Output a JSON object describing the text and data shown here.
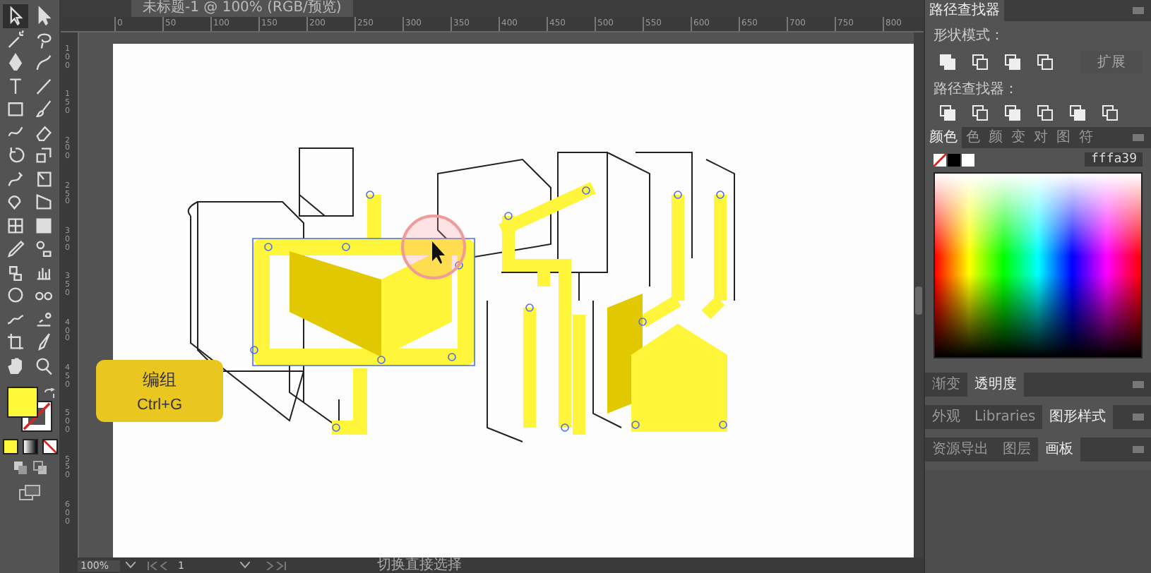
{
  "document_tab": {
    "title": "未标题-1 @ 100% (RGB/预览)"
  },
  "toolbar": {
    "tools": [
      {
        "kind": "select",
        "selected": true
      },
      {
        "kind": "direct",
        "selected": false
      },
      {
        "kind": "wand",
        "selected": false
      },
      {
        "kind": "lasso",
        "selected": false
      },
      {
        "kind": "pen",
        "selected": false
      },
      {
        "kind": "curvature",
        "selected": false
      },
      {
        "kind": "type",
        "selected": false
      },
      {
        "kind": "line",
        "selected": false
      },
      {
        "kind": "rect",
        "selected": false
      },
      {
        "kind": "brush",
        "selected": false
      },
      {
        "kind": "shaper",
        "selected": false
      },
      {
        "kind": "eraser",
        "selected": false
      },
      {
        "kind": "rotate",
        "selected": false
      },
      {
        "kind": "scale",
        "selected": false
      },
      {
        "kind": "warp",
        "selected": false
      },
      {
        "kind": "freetransform",
        "selected": false
      },
      {
        "kind": "shapebuilder",
        "selected": false
      },
      {
        "kind": "perspective",
        "selected": false
      },
      {
        "kind": "mesh",
        "selected": false
      },
      {
        "kind": "gradient",
        "selected": false
      },
      {
        "kind": "eyedropper",
        "selected": false
      },
      {
        "kind": "blend",
        "selected": false
      },
      {
        "kind": "symbol",
        "selected": false
      },
      {
        "kind": "graph",
        "selected": false
      },
      {
        "kind": "ellipse",
        "selected": false
      },
      {
        "kind": "glasses",
        "selected": false
      },
      {
        "kind": "wave",
        "selected": false
      },
      {
        "kind": "chart",
        "selected": false
      },
      {
        "kind": "artboard",
        "selected": false
      },
      {
        "kind": "slice",
        "selected": false
      },
      {
        "kind": "hand",
        "selected": false
      },
      {
        "kind": "zoom",
        "selected": false
      }
    ]
  },
  "top_ruler": {
    "labels": [
      "0",
      "50",
      "100",
      "150",
      "200",
      "250",
      "300",
      "350",
      "400",
      "450",
      "500",
      "550",
      "600",
      "650",
      "700",
      "750",
      "800"
    ]
  },
  "left_ruler": {
    "labels": [
      "100",
      "150",
      "200",
      "250",
      "300",
      "350",
      "400",
      "450",
      "500",
      "550",
      "600"
    ]
  },
  "tooltip": {
    "title": "编组",
    "shortcut": "Ctrl+G"
  },
  "status_bar": {
    "zoom": "100%",
    "artboard": "1",
    "message": "切换直接选择"
  },
  "pathfinder_panel": {
    "tab": "路径查找器",
    "shape_modes_label": "形状模式：",
    "expand_button": {
      "label": "扩展",
      "disabled": true
    },
    "pathfinders_label": "路径查找器："
  },
  "color_panel": {
    "tabs": [
      {
        "label": "颜色",
        "selected": true
      },
      {
        "label": "色",
        "selected": false
      },
      {
        "label": "颜",
        "selected": false
      },
      {
        "label": "变",
        "selected": false
      },
      {
        "label": "对",
        "selected": false
      },
      {
        "label": "图",
        "selected": false
      },
      {
        "label": "符",
        "selected": false
      }
    ],
    "hex_value": "fffa39"
  },
  "panel_groups": [
    {
      "tabs": [
        {
          "label": "渐变",
          "selected": false
        },
        {
          "label": "透明度",
          "selected": true
        }
      ]
    },
    {
      "tabs": [
        {
          "label": "外观",
          "selected": false
        },
        {
          "label": "Libraries",
          "selected": false
        },
        {
          "label": "图形样式",
          "selected": true
        }
      ]
    },
    {
      "tabs": [
        {
          "label": "资源导出",
          "selected": false
        },
        {
          "label": "图层",
          "selected": false
        },
        {
          "label": "画板",
          "selected": true
        }
      ]
    }
  ]
}
